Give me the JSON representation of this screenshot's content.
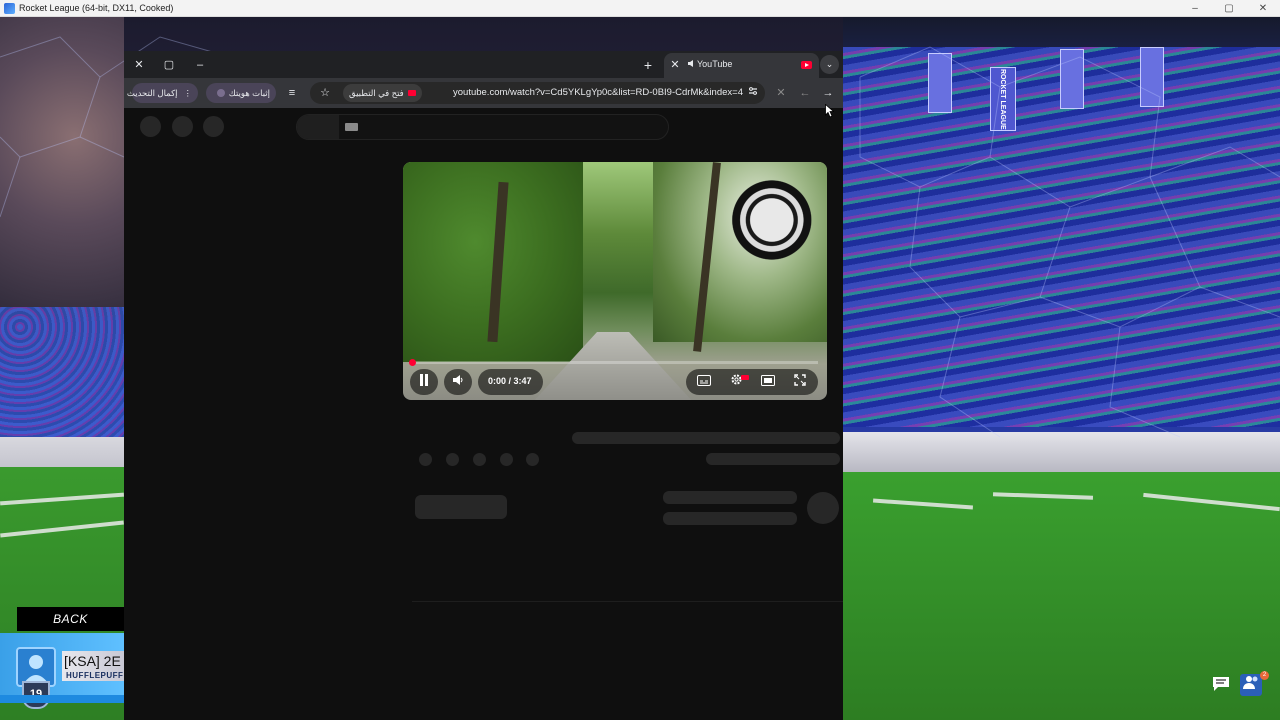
{
  "os_window": {
    "title": "Rocket League (64-bit, DX11, Cooked)",
    "controls": [
      "–",
      "▢",
      "✕"
    ]
  },
  "game": {
    "back_label": "BACK",
    "player_name": "[KSA] 2E",
    "player_subtitle": "HUFFLEPUFF",
    "player_level": "19",
    "notification_count": "2",
    "banner_text": "ROCKET LEAGUE"
  },
  "browser": {
    "window_buttons": {
      "close": "✕",
      "maximize": "▢",
      "minimize": "–"
    },
    "new_tab": "+",
    "tab": {
      "close": "✕",
      "audio_icon": "🔊",
      "title": "YouTube"
    },
    "tab_dropdown": "⌄",
    "toolbar": {
      "update_button": "إكمال التحديث",
      "profile_button": "إثبات هويتك",
      "reading_list_icon": "≡",
      "bookmark_star": "☆",
      "open_in_app": "فتح في التطبيق",
      "url": "youtube.com/watch?v=Cd5YKLgYp0c&list=RD-0BI9-CdrMk&index=4",
      "site_settings_icon": "⚙",
      "stop_icon": "✕",
      "back_icon": "←",
      "forward_icon": "→"
    }
  },
  "player": {
    "time": "0:00 / 3:47",
    "progress": 0.0,
    "playing": true
  },
  "colors": {
    "accent_red": "#ff0033",
    "browser_dark": "#0f0f0f",
    "chip_purple": "#4a4458"
  },
  "icons": {
    "pause": "pause-icon",
    "volume": "volume-icon",
    "subtitles": "subtitles-icon",
    "settings": "gear-icon",
    "miniplayer": "miniplayer-icon",
    "fullscreen": "fullscreen-icon",
    "chat": "chat-icon",
    "friends": "friends-icon"
  }
}
